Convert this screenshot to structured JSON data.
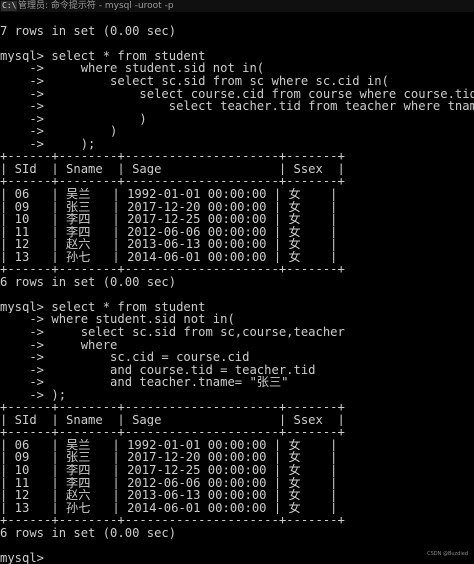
{
  "window": {
    "icon_text": "C:\\",
    "title": "管理员: 命令提示符 - mysql  -uroot -p"
  },
  "console": {
    "lines": [
      "",
      "7 rows in set (0.00 sec)",
      "",
      "mysql> select * from student",
      "    ->     where student.sid not in(",
      "    ->         select sc.sid from sc where sc.cid in(",
      "    ->             select course.cid from course where course.tid in(",
      "    ->                 select teacher.tid from teacher where tname = \"张三\"",
      "    ->             )",
      "    ->         )",
      "    ->     );",
      "+------+--------+---------------------+-------+",
      "| SId  | Sname  | Sage                | Ssex  |",
      "+------+--------+---------------------+-------+",
      "| 06   | 吴兰   | 1992-01-01 00:00:00 | 女    |",
      "| 09   | 张三   | 2017-12-20 00:00:00 | 女    |",
      "| 10   | 李四   | 2017-12-25 00:00:00 | 女    |",
      "| 11   | 李四   | 2012-06-06 00:00:00 | 女    |",
      "| 12   | 赵六   | 2013-06-13 00:00:00 | 女    |",
      "| 13   | 孙七   | 2014-06-01 00:00:00 | 女    |",
      "+------+--------+---------------------+-------+",
      "6 rows in set (0.00 sec)",
      "",
      "mysql> select * from student",
      "    -> where student.sid not in(",
      "    ->     select sc.sid from sc,course,teacher",
      "    ->     where",
      "    ->         sc.cid = course.cid",
      "    ->         and course.tid = teacher.tid",
      "    ->         and teacher.tname= \"张三\"",
      "    -> );",
      "+------+--------+---------------------+-------+",
      "| SId  | Sname  | Sage                | Ssex  |",
      "+------+--------+---------------------+-------+",
      "| 06   | 吴兰   | 1992-01-01 00:00:00 | 女    |",
      "| 09   | 张三   | 2017-12-20 00:00:00 | 女    |",
      "| 10   | 李四   | 2017-12-25 00:00:00 | 女    |",
      "| 11   | 李四   | 2012-06-06 00:00:00 | 女    |",
      "| 12   | 赵六   | 2013-06-13 00:00:00 | 女    |",
      "| 13   | 孙七   | 2014-06-01 00:00:00 | 女    |",
      "+------+--------+---------------------+-------+",
      "6 rows in set (0.00 sec)",
      "",
      "mysql> "
    ]
  },
  "watermark": "CSDN @Buzdied"
}
